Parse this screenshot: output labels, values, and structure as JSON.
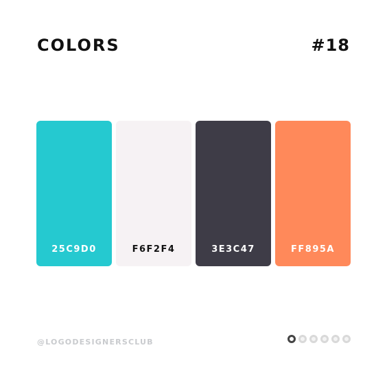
{
  "header": {
    "title": "COLORS",
    "number": "#18"
  },
  "palette": [
    {
      "code": "25C9D0",
      "color": "#25C9D0",
      "text_color": "#ffffff"
    },
    {
      "code": "F6F2F4",
      "color": "#F6F2F4",
      "text_color": "#111111"
    },
    {
      "code": "3E3C47",
      "color": "#3E3C47",
      "text_color": "#ffffff"
    },
    {
      "code": "FF895A",
      "color": "#FF895A",
      "text_color": "#ffffff"
    }
  ],
  "footer": {
    "handle": "@LOGODESIGNERSCLUB",
    "pager": {
      "total": 6,
      "current": 1
    }
  }
}
